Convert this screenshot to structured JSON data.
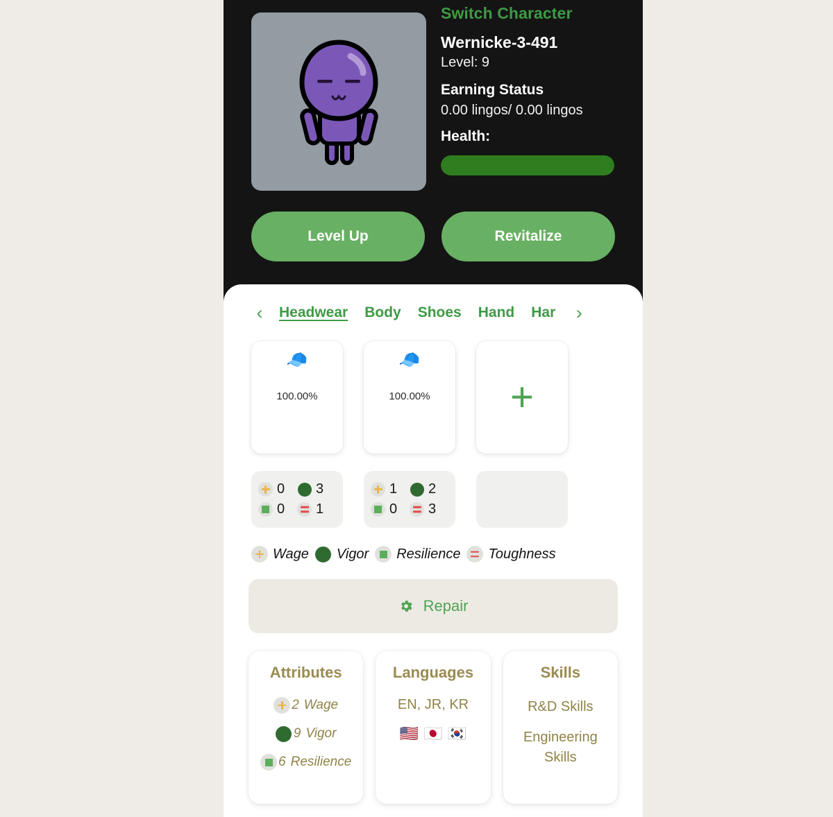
{
  "hero": {
    "switch_character": "Switch Character",
    "character_name": "Wernicke-3-491",
    "level_label": "Level: 9",
    "earning_status_title": "Earning Status",
    "earning_status_value": "0.00 lingos/ 0.00 lingos",
    "health_label": "Health:",
    "health_percent": 100,
    "level_up_button": "Level Up",
    "revitalize_button": "Revitalize",
    "avatar_icon": "character-avatar"
  },
  "tabs": {
    "prev_icon": "chevron-left-icon",
    "next_icon": "chevron-right-icon",
    "items": [
      {
        "label": "Headwear",
        "active": true
      },
      {
        "label": "Body",
        "active": false
      },
      {
        "label": "Shoes",
        "active": false
      },
      {
        "label": "Hand",
        "active": false
      },
      {
        "label": "Har",
        "active": false
      }
    ]
  },
  "items": [
    {
      "emoji": "🧢",
      "icon_name": "billed-cap-icon",
      "durability": "100.00%"
    },
    {
      "emoji": "🧢",
      "icon_name": "billed-cap-icon",
      "durability": "100.00%"
    }
  ],
  "add_item": {
    "icon_name": "plus-icon",
    "glyph": "+"
  },
  "item_stats": [
    {
      "wage": "0",
      "vigor": "3",
      "resilience": "0",
      "toughness": "1"
    },
    {
      "wage": "1",
      "vigor": "2",
      "resilience": "0",
      "toughness": "3"
    }
  ],
  "legend": [
    {
      "label": "Wage",
      "icon": "plus-chip-icon",
      "color": "#E8B647"
    },
    {
      "label": "Vigor",
      "icon": "circle-chip-icon",
      "color": "#2F6B30"
    },
    {
      "label": "Resilience",
      "icon": "square-chip-icon",
      "color": "#5CAE5C"
    },
    {
      "label": "Toughness",
      "icon": "equals-chip-icon",
      "color": "#E04A4A"
    }
  ],
  "repair": {
    "label": "Repair",
    "icon": "gear-icon"
  },
  "attributes_card": {
    "title": "Attributes",
    "rows": [
      {
        "value": "2",
        "name": "Wage",
        "icon": "plus-chip-icon"
      },
      {
        "value": "9",
        "name": "Vigor",
        "icon": "circle-chip-icon"
      },
      {
        "value": "6",
        "name": "Resilience",
        "icon": "square-chip-icon"
      }
    ]
  },
  "languages_card": {
    "title": "Languages",
    "codes": "EN, JR, KR",
    "flags": [
      {
        "name": "flag-us-icon",
        "emoji": "🇺🇸"
      },
      {
        "name": "flag-jp-icon",
        "emoji": "🇯🇵"
      },
      {
        "name": "flag-kr-icon",
        "emoji": "🇰🇷"
      }
    ]
  },
  "skills_card": {
    "title": "Skills",
    "items": [
      "R&D Skills",
      "Engineering Skills"
    ]
  },
  "colors": {
    "page_background": "#EFEBE7",
    "panel_dark": "#141414",
    "accent_green": "#3E9A45",
    "button_green": "#68B063",
    "health_green": "#2E7D1E",
    "gold_text": "#8F8348",
    "avatar_body": "#7B58B8",
    "avatar_bg": "#939BA3"
  }
}
